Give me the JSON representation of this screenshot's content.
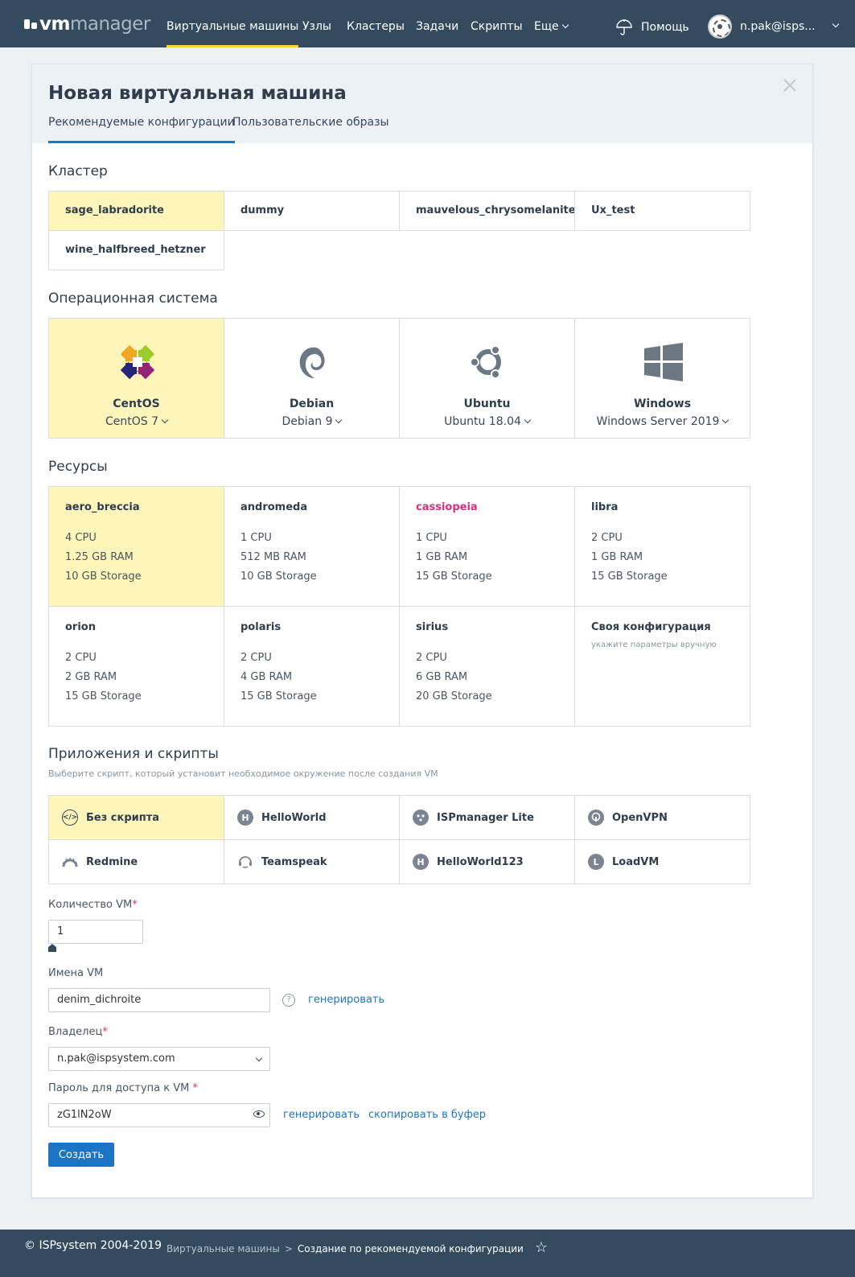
{
  "navbar": {
    "logo_vm": "vm",
    "logo_manager": "manager",
    "items": [
      "Виртуальные машины",
      "Узлы",
      "Кластеры",
      "Задачи",
      "Скрипты",
      "Еще"
    ],
    "help": "Помощь",
    "user": "n.pak@isps..."
  },
  "modal": {
    "title": "Новая виртуальная машина",
    "tabs": [
      "Рекомендуемые конфигурации",
      "Пользовательские образы"
    ]
  },
  "cluster": {
    "title": "Кластер",
    "items": [
      "sage_labradorite",
      "dummy",
      "mauvelous_chrysomelanite",
      "Ux_test",
      "wine_halfbreed_hetzner"
    ]
  },
  "os": {
    "title": "Операционная система",
    "items": [
      {
        "name": "CentOS",
        "version": "CentOS 7",
        "icon": "centos-icon"
      },
      {
        "name": "Debian",
        "version": "Debian 9",
        "icon": "debian-icon"
      },
      {
        "name": "Ubuntu",
        "version": "Ubuntu 18.04",
        "icon": "ubuntu-icon"
      },
      {
        "name": "Windows",
        "version": "Windows Server 2019",
        "icon": "windows-icon"
      }
    ]
  },
  "resources": {
    "title": "Ресурсы",
    "items": [
      {
        "name": "aero_breccia",
        "cpu": "4 CPU",
        "ram": "1.25 GB RAM",
        "storage": "10 GB Storage"
      },
      {
        "name": "andromeda",
        "cpu": "1 CPU",
        "ram": "512 MB RAM",
        "storage": "10 GB Storage"
      },
      {
        "name": "cassiopeia",
        "cpu": "1 CPU",
        "ram": "1 GB RAM",
        "storage": "15 GB Storage"
      },
      {
        "name": "libra",
        "cpu": "2 CPU",
        "ram": "1 GB RAM",
        "storage": "15 GB Storage"
      },
      {
        "name": "orion",
        "cpu": "2 CPU",
        "ram": "2 GB RAM",
        "storage": "15 GB Storage"
      },
      {
        "name": "polaris",
        "cpu": "2 CPU",
        "ram": "4 GB RAM",
        "storage": "15 GB Storage"
      },
      {
        "name": "sirius",
        "cpu": "2 CPU",
        "ram": "6 GB RAM",
        "storage": "20 GB Storage"
      }
    ],
    "custom": {
      "name": "Своя конфигурация",
      "hint": "укажите параметры вручную"
    }
  },
  "apps": {
    "title": "Приложения и скрипты",
    "subtitle": "Выберите скрипт, который установит необходимое окружение после создания VM",
    "items": [
      {
        "name": "Без скрипта",
        "icon": "code-icon"
      },
      {
        "name": "HelloWorld",
        "icon": "h-letter-icon",
        "letter": "H"
      },
      {
        "name": "ISPmanager Lite",
        "icon": "ispmanager-icon"
      },
      {
        "name": "OpenVPN",
        "icon": "openvpn-icon"
      },
      {
        "name": "Redmine",
        "icon": "redmine-icon"
      },
      {
        "name": "Teamspeak",
        "icon": "teamspeak-icon"
      },
      {
        "name": "HelloWorld123",
        "icon": "h-letter-icon",
        "letter": "H"
      },
      {
        "name": "LoadVM",
        "icon": "l-letter-icon",
        "letter": "L"
      }
    ]
  },
  "form": {
    "vm_count_label": "Количество VM",
    "vm_count_value": "1",
    "vm_names_label": "Имена VM",
    "vm_names_value": "denim_dichroite",
    "generate": "генерировать",
    "help_q": "?",
    "owner_label": "Владелец",
    "owner_value": "n.pak@ispsystem.com",
    "password_label": "Пароль для доступа к VM",
    "password_value": "zG1lN2oW",
    "copy_link": "скопировать в буфер",
    "required_mark": "*",
    "submit": "Создать"
  },
  "footer": {
    "copyright": "© ISPsystem 2004-2019",
    "breadcrumb": [
      "Виртуальные машины",
      "Создание по рекомендуемой конфигурации"
    ],
    "separator": ">"
  },
  "colors": {
    "navbar": "#344a5e",
    "accent": "#1c74c4",
    "selected": "#fdf5b9",
    "active_tab": "#f0d63c",
    "highlight": "#d6307a"
  }
}
